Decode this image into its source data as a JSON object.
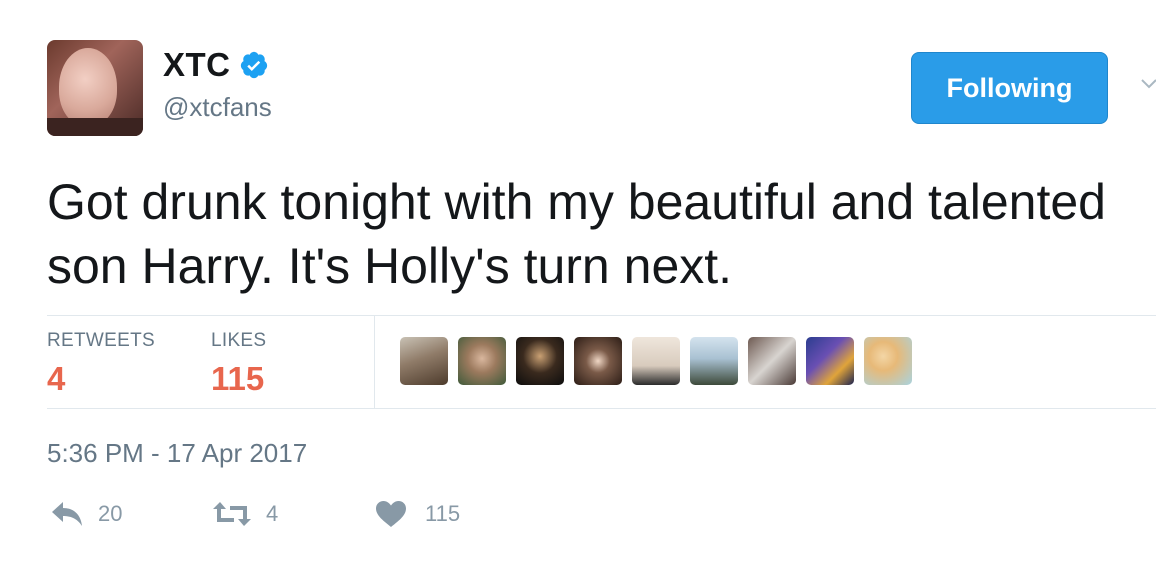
{
  "user": {
    "display_name": "XTC",
    "handle": "@xtcfans",
    "verified": true
  },
  "follow_button": {
    "label": "Following"
  },
  "tweet": {
    "text": "Got drunk tonight with my beautiful and talented son Harry. It's Holly's turn next.",
    "timestamp": "5:36 PM - 17 Apr 2017"
  },
  "stats": {
    "retweets_label": "RETWEETS",
    "retweets_value": "4",
    "likes_label": "LIKES",
    "likes_value": "115"
  },
  "actions": {
    "reply_count": "20",
    "retweet_count": "4",
    "like_count": "115"
  },
  "colors": {
    "accent": "#2a9ce8",
    "stat_value": "#e8664d",
    "muted": "#657786"
  }
}
